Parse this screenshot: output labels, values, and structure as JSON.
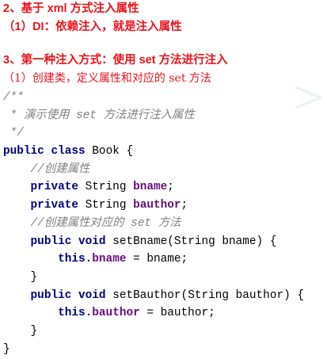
{
  "headings": {
    "h1": "2、基于 xml 方式注入属性",
    "h2": "（1）DI：依赖注入，就是注入属性",
    "h3": "3、第一种注入方式：使用 set 方法进行注入",
    "p1": "（1）创建类，定义属性和对应的 set 方法"
  },
  "code": {
    "doc_open": "/**",
    "doc_body": " * 演示使用 set 方法进行注入属性",
    "doc_close": " */",
    "kw_public": "public",
    "kw_class": "class",
    "kw_private": "private",
    "kw_void": "void",
    "kw_this": "this",
    "class_name": " Book {",
    "comment_create_attr": "//创建属性",
    "type_string": " String ",
    "field_bname": "bname",
    "field_bauthor": "bauthor",
    "semicolon": ";",
    "comment_create_setter": "//创建属性对应的 set 方法",
    "sig_setbname": " setBname(String bname) {",
    "sig_setbauthor": " setBauthor(String bauthor) {",
    "assign_bname": " = bname;",
    "assign_bauthor": " = bauthor;",
    "dot": ".",
    "close_brace": "}",
    "space": " "
  },
  "icons": {
    "watermark": "decorative-chevron-icon",
    "watermark_color": "#e6f3f3"
  }
}
